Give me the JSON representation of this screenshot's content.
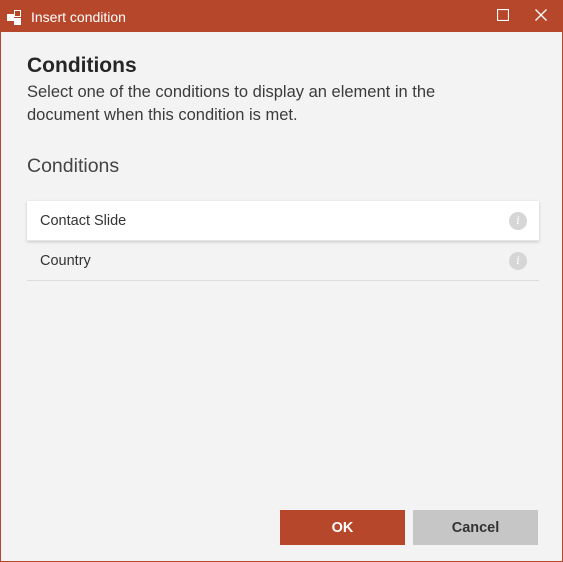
{
  "window": {
    "title": "Insert condition",
    "accent_color": "#b7472a",
    "icons": {
      "app": "app-logo-icon",
      "maximize": "maximize-icon",
      "close": "close-icon"
    }
  },
  "content": {
    "heading": "Conditions",
    "description": "Select one of the conditions to display an element in the document when this condition is met.",
    "section_title": "Conditions",
    "conditions": [
      {
        "label": "Contact Slide",
        "selected": true,
        "icon": "info-icon"
      },
      {
        "label": "Country",
        "selected": false,
        "icon": "info-icon"
      }
    ]
  },
  "buttons": {
    "ok_label": "OK",
    "cancel_label": "Cancel"
  }
}
